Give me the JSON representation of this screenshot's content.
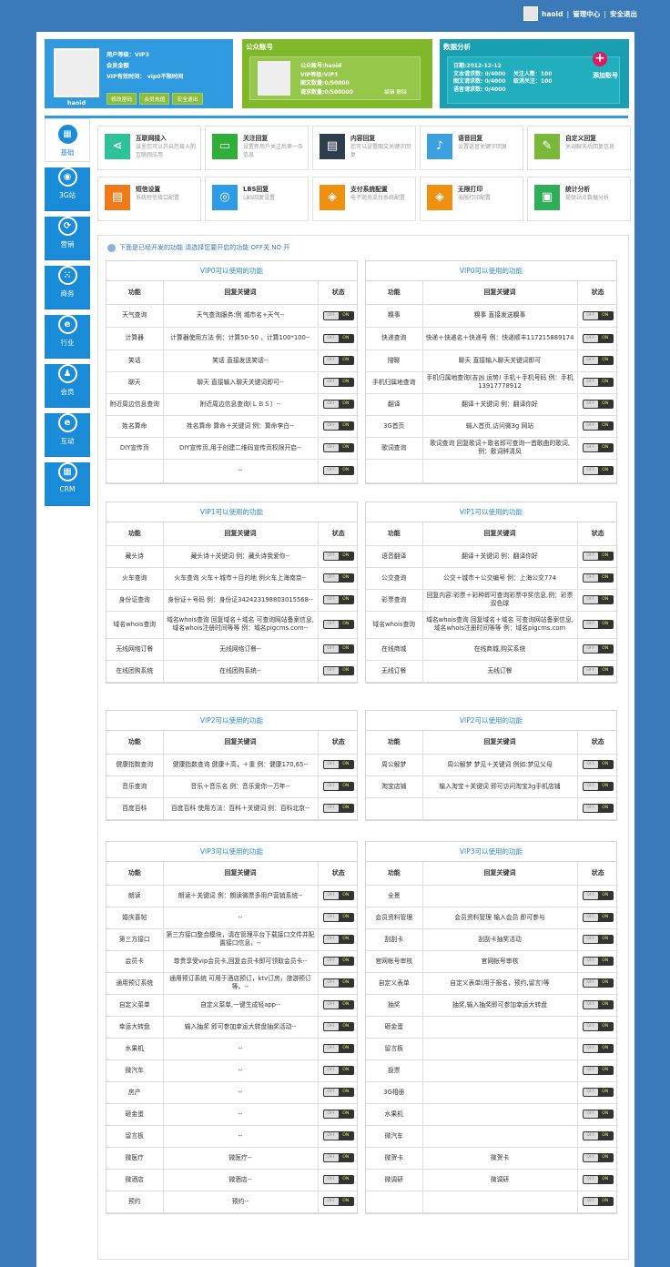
{
  "top": {
    "user": "haoid",
    "center": "管理中心",
    "logout": "安全退出",
    "sep": "|"
  },
  "user_card": {
    "name": "haoid",
    "lines": [
      "用户等级：VIP3",
      "会员金额",
      "VIP有效时间： vip0不限时间"
    ],
    "buttons": [
      "修改密码",
      "会员充值",
      "安全退出"
    ]
  },
  "account_card": {
    "title": "公众账号",
    "lines": [
      "公众账号:haoid",
      "VIP等级:VIP3",
      "图文数量:0/50000",
      "请求数量:0/500000"
    ],
    "links": [
      "编辑",
      "删除"
    ]
  },
  "stats_card": {
    "title": "数据分析",
    "text": "日期:2012-12-12\n文本请求数: 0/4000    关注人数：100\n图文请求数: 0/4000    取消关注：100\n语音请求数: 0/4000",
    "add_label": "添加账号"
  },
  "sidebar": [
    {
      "label": "基础",
      "icon": "▦"
    },
    {
      "label": "3G站",
      "icon": "◉"
    },
    {
      "label": "营销",
      "icon": "⟳"
    },
    {
      "label": "商务",
      "icon": "⁙"
    },
    {
      "label": "行业",
      "icon": "e"
    },
    {
      "label": "会员",
      "icon": "♟"
    },
    {
      "label": "互动",
      "icon": "e"
    },
    {
      "label": "CRM",
      "icon": "▦"
    }
  ],
  "tiles": [
    {
      "title": "互联网接入",
      "desc": "该里您可以开启您接入的互联网应用",
      "color": "#2ec29a",
      "icon": "⋖"
    },
    {
      "title": "关注回复",
      "desc": "设置新用户关注后第一条信息",
      "color": "#2fae38",
      "icon": "▭"
    },
    {
      "title": "内容回复",
      "desc": "您可以设置图文关键字回复",
      "color": "#2f3e4e",
      "icon": "▤"
    },
    {
      "title": "语音回复",
      "desc": "设置语音关键字回复",
      "color": "#3aa0e0",
      "icon": "♪"
    },
    {
      "title": "自定义回复",
      "desc": "关词聊天后回复信息",
      "color": "#7ab83a",
      "icon": "✎"
    },
    {
      "title": "短信设置",
      "desc": "系统短信接口配置",
      "color": "#f07a1a",
      "icon": "▤"
    },
    {
      "title": "LBS回复",
      "desc": "LBS回复设置",
      "color": "#2d9be6",
      "icon": "◎"
    },
    {
      "title": "支付系统配置",
      "desc": "电子商务支付系统配置",
      "color": "#f09010",
      "icon": "◈"
    },
    {
      "title": "无限打印",
      "desc": "无限打印配置",
      "color": "#f09010",
      "icon": "◈"
    },
    {
      "title": "统计分析",
      "desc": "提供站点数据分析",
      "color": "#2fae58",
      "icon": "▣"
    }
  ],
  "notice": "下面是已经开发的功能 请选择您要开启的功能 OFF关 NO 开",
  "headers": [
    "功能",
    "回复关键词",
    "状态"
  ],
  "toggle": {
    "off": "OFF",
    "on": "ON"
  },
  "groups": [
    {
      "title": "VIP0可以使用的功能",
      "rows": [
        [
          "天气查询",
          "天气查询服务:例 城市名+天气--"
        ],
        [
          "计算器",
          "计算器使用方法 例：计算50-50 ，计算100*100--"
        ],
        [
          "笑话",
          "笑话 直接发送笑话--"
        ],
        [
          "聊天",
          "聊天 直接输入聊天关键词即可--"
        ],
        [
          "附近周边信息查询",
          "附近周边信息查询(ＬＢＳ）--"
        ],
        [
          "姓名算命",
          "姓名算命 算命＋关键词 例：算命李白--"
        ],
        [
          "DIY宣传页",
          "DIY宣传页,用于创建二维码宣传页权限开启--"
        ],
        [
          "",
          "--"
        ]
      ]
    },
    {
      "title": "VIP0可以使用的功能",
      "rows": [
        [
          "糗事",
          "糗事 直接发送糗事"
        ],
        [
          "快递查询",
          "快递＋快递名＋快递号 例：快递顺丰117215889174"
        ],
        [
          "陪聊",
          "聊天 直接输入聊天关键词即可"
        ],
        [
          "手机归属地查询",
          "手机归属地查询(吉凶 运势) 手机＋手机号码 例：手机13917778912"
        ],
        [
          "翻译",
          "翻译＋关键词 例：翻译你好"
        ],
        [
          "3G首页",
          "输入首页,访问微3g 网站"
        ],
        [
          "歌词查询",
          "歌词查询 回复歌词＋歌名即可查询一首歌曲的歌词,例：歌词醉清风"
        ],
        [
          "",
          ""
        ]
      ]
    },
    {
      "title": "VIP1可以使用的功能",
      "rows": [
        [
          "藏头诗",
          "藏头诗＋关键词 例：藏头诗我爱你--"
        ],
        [
          "火车查询",
          "火车查询 火车＋城市＋目的地 例火车上海南京--"
        ],
        [
          "身份证查询",
          "身份证＋号码 例：身份证342423198803015568--"
        ],
        [
          "域名whois查询",
          "域名whois查询 回复域名＋域名 可查询网站备案信息,域名whois注册时间等等 例：域名pigcms.com--"
        ],
        [
          "无线网络订餐",
          "无线网络订餐--"
        ],
        [
          "在线团购系统",
          "在线团购系统--"
        ]
      ]
    },
    {
      "title": "VIP1可以使用的功能",
      "rows": [
        [
          "语音翻译",
          "翻译＋关键词 例：翻译你好"
        ],
        [
          "公交查询",
          "公交＋城市＋公交编号 例：上海公交774"
        ],
        [
          "彩票查询",
          "回复内容:彩票＋彩种即可查询彩票中奖信息,例：彩票双色球"
        ],
        [
          "域名whois查询",
          "域名whois查询 回复域名＋域名 可查询网站备案信息,域名whois注册时间等等 例：域名pigcms.com"
        ],
        [
          "在线商城",
          "在线商城,购买系统"
        ],
        [
          "无线订餐",
          "无线订餐"
        ]
      ]
    },
    {
      "title": "VIP2可以使用的功能",
      "rows": [
        [
          "健康指数查询",
          "健康指数查询 健康＋高，＋重 例：健康170,65--"
        ],
        [
          "音乐查询",
          "音乐＋音乐名 例：音乐爱你一万年--"
        ],
        [
          "百度百科",
          "百度百科 使用方法：百科＋关键词 例：百科北京--"
        ]
      ]
    },
    {
      "title": "VIP2可以使用的功能",
      "rows": [
        [
          "周公解梦",
          "周公解梦 梦见＋关键词 例如:梦见父母"
        ],
        [
          "淘宝店铺",
          "输入淘宝＋关键词 即可访问淘宝3g手机店铺"
        ],
        [
          "",
          ""
        ]
      ]
    },
    {
      "title": "VIP3可以使用的功能",
      "rows": [
        [
          "朗读",
          "朗读＋关键词 例：朗读微票多用户营销系统--"
        ],
        [
          "婚庆喜帖",
          "--"
        ],
        [
          "第三方接口",
          "第三方接口整合模块，请在管理平台下载接口文件并配置接口信息，--"
        ],
        [
          "会员卡",
          "尊贵享受vip会员卡,回复会员卡即可领取会员卡--"
        ],
        [
          "通用预订系统",
          "通用预订系统 可用于酒店预订，ktv订房，旅游预订等。--"
        ],
        [
          "自定义菜单",
          "自定义菜单,一键生成轻app--"
        ],
        [
          "幸运大转盘",
          "输入抽奖 即可参加幸运大转盘抽奖活动--"
        ],
        [
          "水果机",
          "--"
        ],
        [
          "微汽车",
          "--"
        ],
        [
          "房产",
          "--"
        ],
        [
          "砸金蛋",
          "--"
        ],
        [
          "留言板",
          "--"
        ],
        [
          "微医疗",
          "微医疗--"
        ],
        [
          "微酒店",
          "微酒店--"
        ],
        [
          "预约",
          "预约--"
        ]
      ]
    },
    {
      "title": "VIP3可以使用的功能",
      "rows": [
        [
          "全景",
          ""
        ],
        [
          "会员资料管理",
          "会员资料管理 输入会员 即可参与"
        ],
        [
          "刮刮卡",
          "刮刮卡抽奖活动"
        ],
        [
          "官网帐号审核",
          "官网帐号审核"
        ],
        [
          "自定义表单",
          "自定义表单(用于报名，预约,留言)等"
        ],
        [
          "抽奖",
          "抽奖,输入抽奖即可参加幸运大转盘"
        ],
        [
          "砸金蛋",
          ""
        ],
        [
          "留言板",
          ""
        ],
        [
          "投票",
          ""
        ],
        [
          "3G相册",
          ""
        ],
        [
          "水果机",
          ""
        ],
        [
          "微汽车",
          ""
        ],
        [
          "微贺卡",
          "微贺卡"
        ],
        [
          "微调研",
          "微调研"
        ],
        [
          "",
          ""
        ]
      ]
    }
  ]
}
